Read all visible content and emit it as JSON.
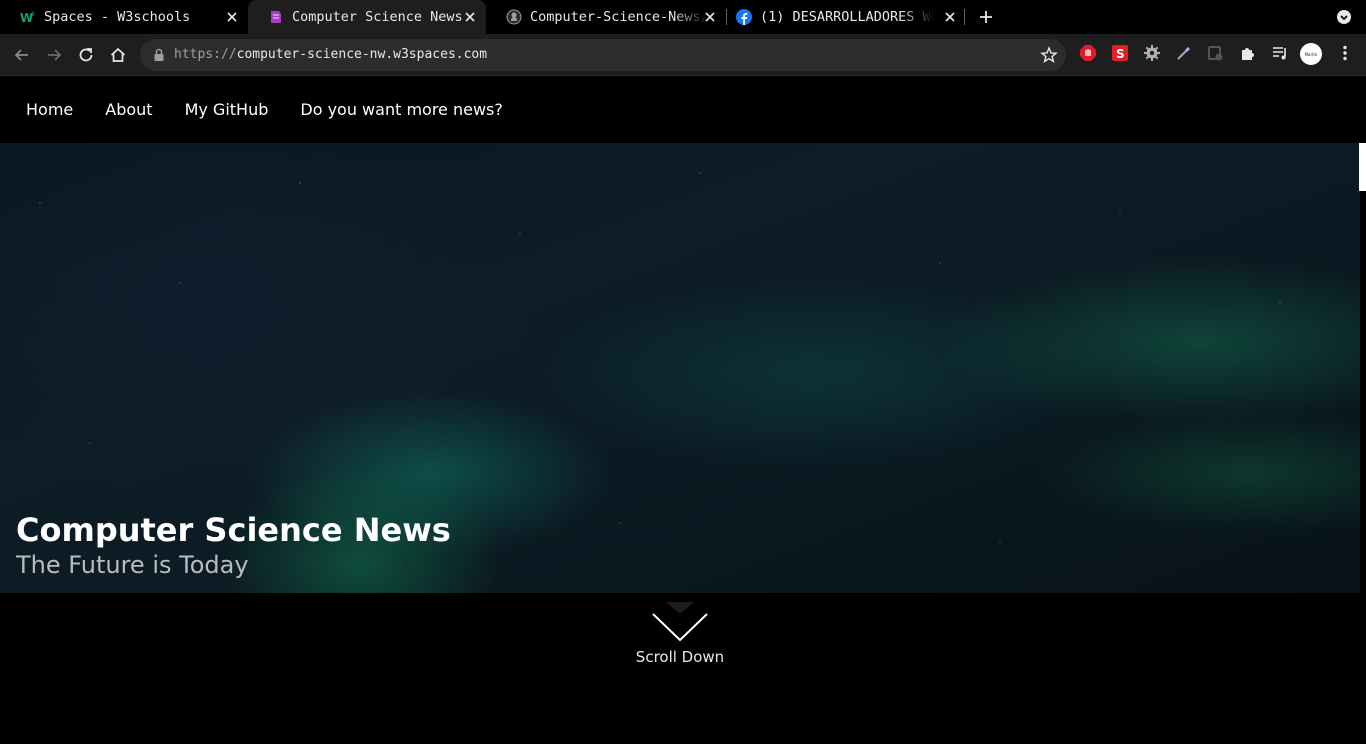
{
  "browser": {
    "tabs": [
      {
        "title": "Spaces - W3schools",
        "active": false,
        "favicon": "w3schools-icon"
      },
      {
        "title": "Computer Science News",
        "active": true,
        "favicon": "w3spaces-icon"
      },
      {
        "title": "Computer-Science-News/",
        "active": false,
        "favicon": "github-icon"
      },
      {
        "title": "(1) DESARROLLADORES WE",
        "active": false,
        "favicon": "facebook-icon"
      }
    ],
    "url_scheme": "https://",
    "url_host": "computer-science-nw.w3spaces.com",
    "profile_label": "Martin"
  },
  "page": {
    "nav": [
      "Home",
      "About",
      "My GitHub",
      "Do you want more news?"
    ],
    "hero": {
      "title": "Computer Science News",
      "subtitle": "The Future is Today"
    },
    "scroll_label": "Scroll Down"
  },
  "colors": {
    "page_bg": "#000000",
    "toolbar_bg": "#1e1e1e",
    "omnibox_bg": "#2c2c2c"
  }
}
